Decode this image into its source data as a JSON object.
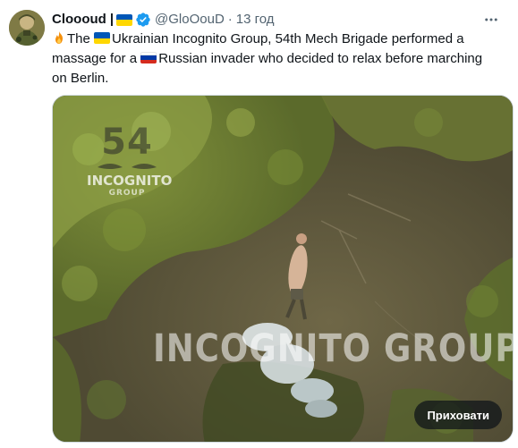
{
  "author": {
    "display_name": "Clooоud",
    "name_separator": "|",
    "handle": "@GloOouD",
    "dot": "·",
    "time": "13 год",
    "flag_colors": {
      "top": "#0057b7",
      "bottom": "#ffd700"
    },
    "verified_color": "#1d9bf0",
    "avatar_icon": "soldier-avatar"
  },
  "more_icon": "more-horizontal-icon",
  "tweet": {
    "seg1": "The ",
    "seg2": "Ukrainian Incognito Group, 54th Mech Brigade performed a massage for a ",
    "seg3": "Russian invader who decided to relax before marching on Berlin.",
    "emoji_fire": "fire-emoji",
    "flag_ua": {
      "top": "#0057b7",
      "bottom": "#ffd700"
    },
    "flag_ru": {
      "top": "#ffffff",
      "mid": "#0039a6",
      "bottom": "#d52b1e"
    }
  },
  "media": {
    "watermark_number": "54",
    "watermark_name": "INCOGNITO",
    "watermark_sub": "GROUP",
    "watermark_big": "INCOGNITO GROUP",
    "hide_button_label": "Приховати"
  }
}
